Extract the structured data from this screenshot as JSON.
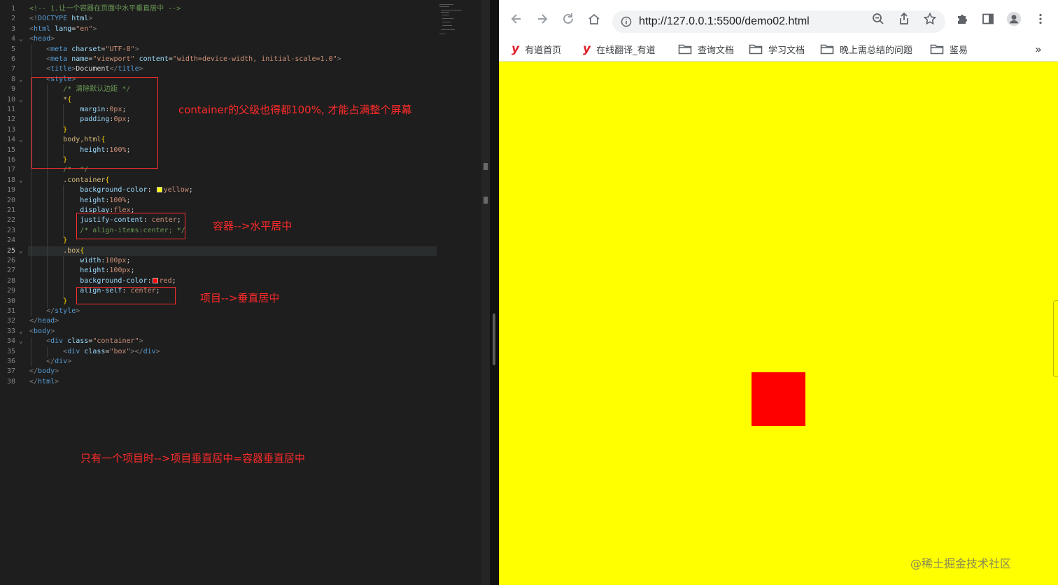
{
  "editor": {
    "lines": [
      [
        [
          "t-com",
          "<!-- 1.让一个容器在页面中水平垂直居中 -->"
        ]
      ],
      [
        [
          "t-pun",
          "<!"
        ],
        [
          "t-tag",
          "DOCTYPE"
        ],
        [
          "t-txt",
          " "
        ],
        [
          "t-attr",
          "html"
        ],
        [
          "t-pun",
          ">"
        ]
      ],
      [
        [
          "t-pun",
          "<"
        ],
        [
          "t-tag",
          "html"
        ],
        [
          "t-txt",
          " "
        ],
        [
          "t-attr",
          "lang"
        ],
        [
          "t-txt",
          "="
        ],
        [
          "t-str",
          "\"en\""
        ],
        [
          "t-pun",
          ">"
        ]
      ],
      [
        [
          "t-pun",
          "<"
        ],
        [
          "t-tag",
          "head"
        ],
        [
          "t-pun",
          ">"
        ]
      ],
      [
        [
          "t-txt",
          "    "
        ],
        [
          "t-pun",
          "<"
        ],
        [
          "t-tag",
          "meta"
        ],
        [
          "t-txt",
          " "
        ],
        [
          "t-attr",
          "charset"
        ],
        [
          "t-txt",
          "="
        ],
        [
          "t-str",
          "\"UTF-8\""
        ],
        [
          "t-pun",
          ">"
        ]
      ],
      [
        [
          "t-txt",
          "    "
        ],
        [
          "t-pun",
          "<"
        ],
        [
          "t-tag",
          "meta"
        ],
        [
          "t-txt",
          " "
        ],
        [
          "t-attr",
          "name"
        ],
        [
          "t-txt",
          "="
        ],
        [
          "t-str",
          "\"viewport\""
        ],
        [
          "t-txt",
          " "
        ],
        [
          "t-attr",
          "content"
        ],
        [
          "t-txt",
          "="
        ],
        [
          "t-str",
          "\"width=device-width, initial-scale=1.0\""
        ],
        [
          "t-pun",
          ">"
        ]
      ],
      [
        [
          "t-txt",
          "    "
        ],
        [
          "t-pun",
          "<"
        ],
        [
          "t-tag",
          "title"
        ],
        [
          "t-pun",
          ">"
        ],
        [
          "t-txt",
          "Document"
        ],
        [
          "t-pun",
          "</"
        ],
        [
          "t-tag",
          "title"
        ],
        [
          "t-pun",
          ">"
        ]
      ],
      [
        [
          "t-txt",
          "    "
        ],
        [
          "t-pun",
          "<"
        ],
        [
          "t-tag",
          "style"
        ],
        [
          "t-pun",
          ">"
        ]
      ],
      [
        [
          "t-txt",
          "        "
        ],
        [
          "t-com",
          "/* 清除默认边距 */"
        ]
      ],
      [
        [
          "t-txt",
          "        "
        ],
        [
          "t-sel",
          "*"
        ],
        [
          "t-brk",
          "{"
        ]
      ],
      [
        [
          "t-txt",
          "            "
        ],
        [
          "t-prop",
          "margin"
        ],
        [
          "t-txt",
          ":"
        ],
        [
          "t-val",
          "0px"
        ],
        [
          "t-txt",
          ";"
        ]
      ],
      [
        [
          "t-txt",
          "            "
        ],
        [
          "t-prop",
          "padding"
        ],
        [
          "t-txt",
          ":"
        ],
        [
          "t-val",
          "0px"
        ],
        [
          "t-txt",
          ";"
        ]
      ],
      [
        [
          "t-txt",
          "        "
        ],
        [
          "t-brk",
          "}"
        ]
      ],
      [
        [
          "t-txt",
          "        "
        ],
        [
          "t-sel",
          "body,html"
        ],
        [
          "t-brk",
          "{"
        ]
      ],
      [
        [
          "t-txt",
          "            "
        ],
        [
          "t-prop",
          "height"
        ],
        [
          "t-txt",
          ":"
        ],
        [
          "t-val",
          "100%"
        ],
        [
          "t-txt",
          ";"
        ]
      ],
      [
        [
          "t-txt",
          "        "
        ],
        [
          "t-brk",
          "}"
        ]
      ],
      [
        [
          "t-txt",
          "        "
        ],
        [
          "t-com",
          "/*  */"
        ]
      ],
      [
        [
          "t-txt",
          "        "
        ],
        [
          "t-sel",
          ".container"
        ],
        [
          "t-brk",
          "{"
        ]
      ],
      [
        [
          "t-txt",
          "            "
        ],
        [
          "t-prop",
          "background-color"
        ],
        [
          "t-txt",
          ": "
        ],
        [
          "t-sw",
          "#ffff00"
        ],
        [
          "t-val",
          "yellow"
        ],
        [
          "t-txt",
          ";"
        ]
      ],
      [
        [
          "t-txt",
          "            "
        ],
        [
          "t-prop",
          "height"
        ],
        [
          "t-txt",
          ":"
        ],
        [
          "t-val",
          "100%"
        ],
        [
          "t-txt",
          ";"
        ]
      ],
      [
        [
          "t-txt",
          "            "
        ],
        [
          "t-prop",
          "display"
        ],
        [
          "t-txt",
          ":"
        ],
        [
          "t-val",
          "flex"
        ],
        [
          "t-txt",
          ";"
        ]
      ],
      [
        [
          "t-txt",
          "            "
        ],
        [
          "t-prop",
          "justify-content"
        ],
        [
          "t-txt",
          ": "
        ],
        [
          "t-val",
          "center"
        ],
        [
          "t-txt",
          ";"
        ]
      ],
      [
        [
          "t-txt",
          "            "
        ],
        [
          "t-com",
          "/* align-items:center; */"
        ]
      ],
      [
        [
          "t-txt",
          "        "
        ],
        [
          "t-brk",
          "}"
        ]
      ],
      [
        [
          "t-txt",
          "        "
        ],
        [
          "t-sel",
          ".box"
        ],
        [
          "t-brk",
          "{"
        ]
      ],
      [
        [
          "t-txt",
          "            "
        ],
        [
          "t-prop",
          "width"
        ],
        [
          "t-txt",
          ":"
        ],
        [
          "t-val",
          "100px"
        ],
        [
          "t-txt",
          ";"
        ]
      ],
      [
        [
          "t-txt",
          "            "
        ],
        [
          "t-prop",
          "height"
        ],
        [
          "t-txt",
          ":"
        ],
        [
          "t-val",
          "100px"
        ],
        [
          "t-txt",
          ";"
        ]
      ],
      [
        [
          "t-txt",
          "            "
        ],
        [
          "t-prop",
          "background-color"
        ],
        [
          "t-txt",
          ":"
        ],
        [
          "t-sw",
          "#ff0000"
        ],
        [
          "t-val",
          "red"
        ],
        [
          "t-txt",
          ";"
        ]
      ],
      [
        [
          "t-txt",
          "            "
        ],
        [
          "t-prop",
          "align-self"
        ],
        [
          "t-txt",
          ": "
        ],
        [
          "t-val",
          "center"
        ],
        [
          "t-txt",
          ";"
        ]
      ],
      [
        [
          "t-txt",
          "        "
        ],
        [
          "t-brk",
          "}"
        ]
      ],
      [
        [
          "t-txt",
          "    "
        ],
        [
          "t-pun",
          "</"
        ],
        [
          "t-tag",
          "style"
        ],
        [
          "t-pun",
          ">"
        ]
      ],
      [
        [
          "t-pun",
          "</"
        ],
        [
          "t-tag",
          "head"
        ],
        [
          "t-pun",
          ">"
        ]
      ],
      [
        [
          "t-pun",
          "<"
        ],
        [
          "t-tag",
          "body"
        ],
        [
          "t-pun",
          ">"
        ]
      ],
      [
        [
          "t-txt",
          "    "
        ],
        [
          "t-pun",
          "<"
        ],
        [
          "t-tag",
          "div"
        ],
        [
          "t-txt",
          " "
        ],
        [
          "t-attr",
          "class"
        ],
        [
          "t-txt",
          "="
        ],
        [
          "t-str",
          "\"container\""
        ],
        [
          "t-pun",
          ">"
        ]
      ],
      [
        [
          "t-txt",
          "        "
        ],
        [
          "t-pun",
          "<"
        ],
        [
          "t-tag",
          "div"
        ],
        [
          "t-txt",
          " "
        ],
        [
          "t-attr",
          "class"
        ],
        [
          "t-txt",
          "="
        ],
        [
          "t-str",
          "\"box\""
        ],
        [
          "t-pun",
          "></"
        ],
        [
          "t-tag",
          "div"
        ],
        [
          "t-pun",
          ">"
        ]
      ],
      [
        [
          "t-txt",
          "    "
        ],
        [
          "t-pun",
          "</"
        ],
        [
          "t-tag",
          "div"
        ],
        [
          "t-pun",
          ">"
        ]
      ],
      [
        [
          "t-pun",
          "</"
        ],
        [
          "t-tag",
          "body"
        ],
        [
          "t-pun",
          ">"
        ]
      ],
      [
        [
          "t-pun",
          "</"
        ],
        [
          "t-tag",
          "html"
        ],
        [
          "t-pun",
          ">"
        ]
      ]
    ],
    "folds": [
      4,
      8,
      10,
      14,
      18,
      25,
      33,
      34
    ],
    "active_line": 25
  },
  "annotations": {
    "container_parent": "container的父级也得都100%, 才能占满整个屏幕",
    "horizontal": "容器-->水平居中",
    "vertical": "项目-->垂直居中",
    "single_item": "只有一个项目时-->项目垂直居中=容器垂直居中"
  },
  "browser": {
    "url": "http://127.0.0.1:5500/demo02.html",
    "bookmarks": [
      {
        "label": "有道首页",
        "icon": "youdao"
      },
      {
        "label": "在线翻译_有道",
        "icon": "youdao"
      },
      {
        "label": "查询文档",
        "icon": "folder"
      },
      {
        "label": "学习文档",
        "icon": "folder"
      },
      {
        "label": "晚上需总结的问题",
        "icon": "folder"
      },
      {
        "label": "鉴易",
        "icon": "folder"
      }
    ],
    "more_bookmarks": "»",
    "youdao_glyph": "y",
    "page_background": "#ffff00",
    "box_color": "#ff0000"
  },
  "watermark": "@稀土掘金技术社区"
}
